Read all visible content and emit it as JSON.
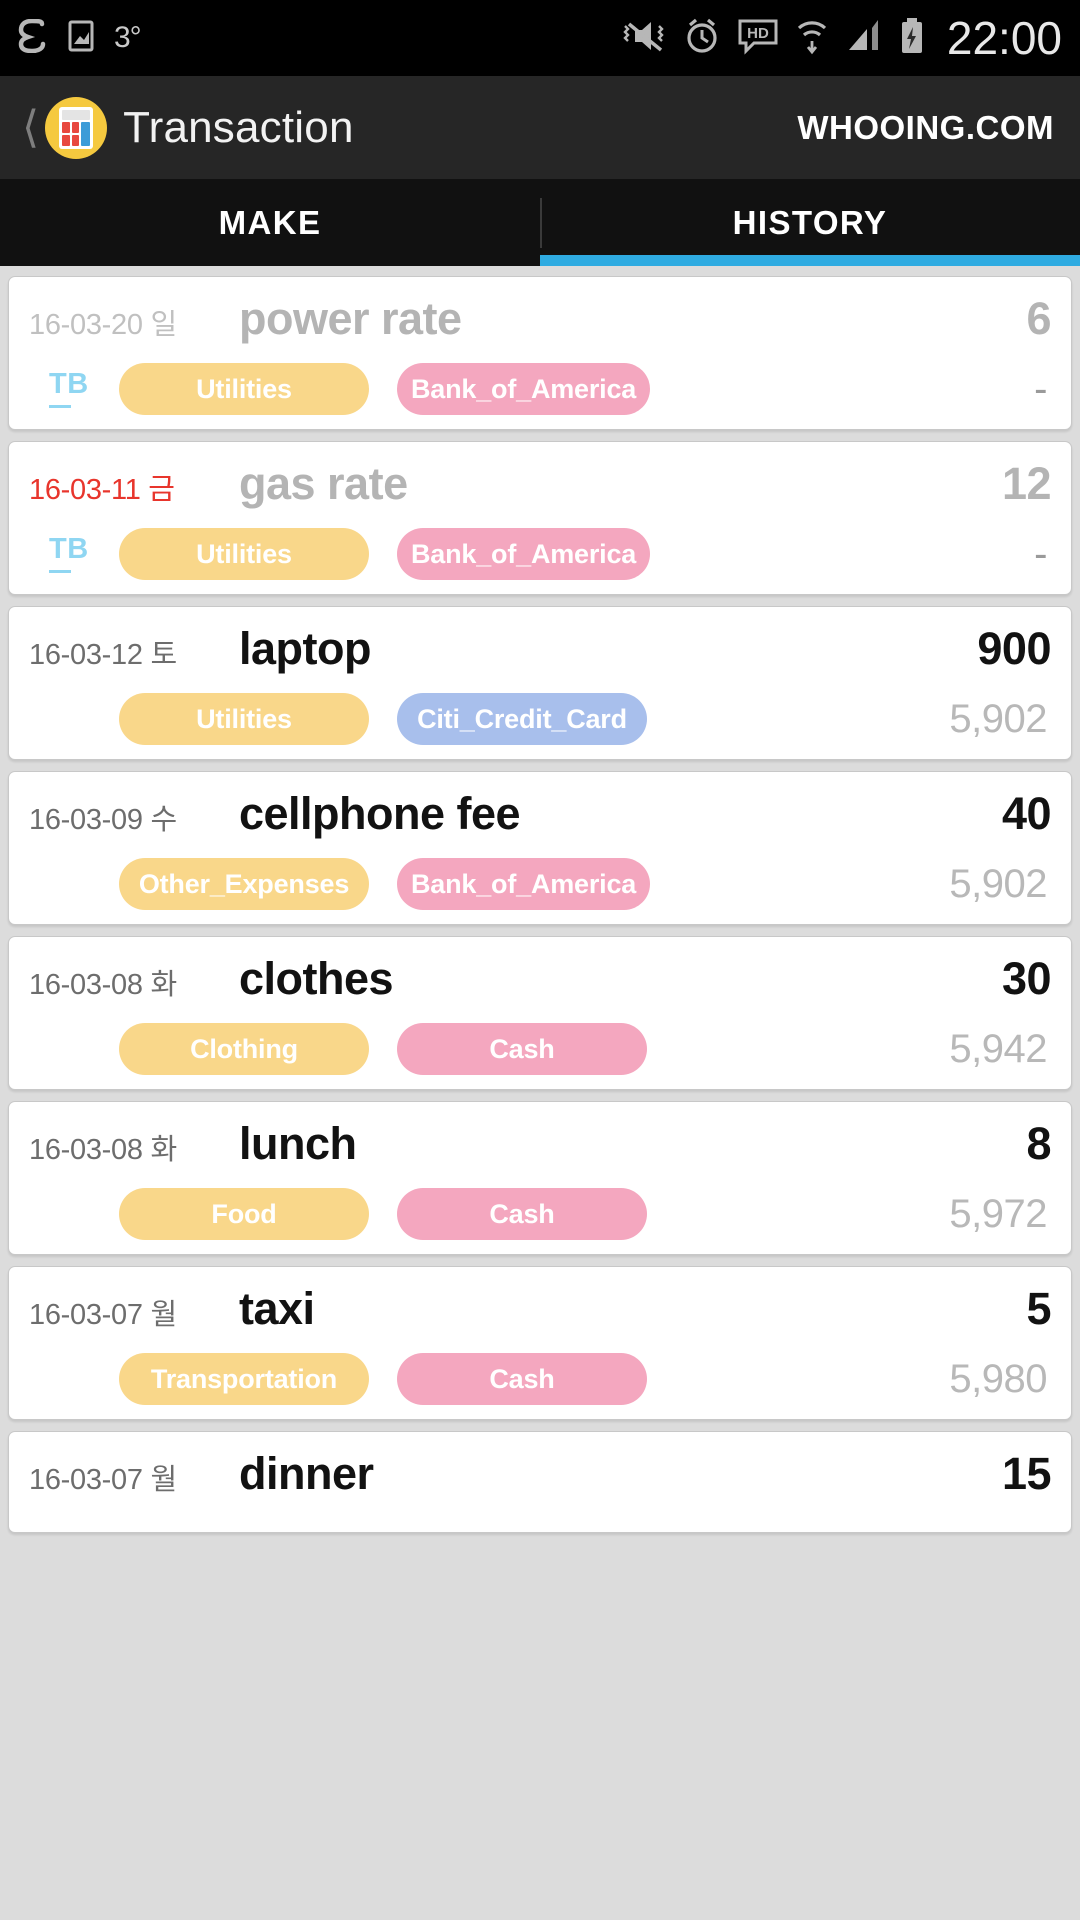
{
  "statusbar": {
    "temperature": "3°",
    "clock": "22:00",
    "icons_left": [
      "sigma-icon",
      "screenshot-icon"
    ],
    "icons_right": [
      "vibrate-mute-icon",
      "alarm-icon",
      "hd-icon",
      "wifi-icon",
      "signal-icon",
      "battery-charging-icon"
    ]
  },
  "appbar": {
    "back_icon": "back-chevron-icon",
    "logo_icon": "calculator-icon",
    "title": "Transaction",
    "brand": "WHOOING.COM"
  },
  "tabs": {
    "items": [
      {
        "label": "MAKE",
        "active": false
      },
      {
        "label": "HISTORY",
        "active": true
      }
    ],
    "indicator_color": "#2fabe1"
  },
  "transactions": [
    {
      "date": "16-03-20 일",
      "date_style": "muted",
      "title": "power rate",
      "amount": "6",
      "muted": true,
      "tb": "TB",
      "category": "Utilities",
      "category_color": "yellow",
      "account": "Bank_of_America",
      "account_color": "pink",
      "balance": "-"
    },
    {
      "date": "16-03-11 금",
      "date_style": "holiday",
      "title": "gas rate",
      "amount": "12",
      "muted": true,
      "tb": "TB",
      "category": "Utilities",
      "category_color": "yellow",
      "account": "Bank_of_America",
      "account_color": "pink",
      "balance": "-"
    },
    {
      "date": "16-03-12 토",
      "date_style": "normal",
      "title": "laptop",
      "amount": "900",
      "muted": false,
      "tb": "",
      "category": "Utilities",
      "category_color": "yellow",
      "account": "Citi_Credit_Card",
      "account_color": "blue",
      "balance": "5,902"
    },
    {
      "date": "16-03-09 수",
      "date_style": "normal",
      "title": "cellphone fee",
      "amount": "40",
      "muted": false,
      "tb": "",
      "category": "Other_Expenses",
      "category_color": "yellow",
      "account": "Bank_of_America",
      "account_color": "pink",
      "balance": "5,902"
    },
    {
      "date": "16-03-08 화",
      "date_style": "normal",
      "title": "clothes",
      "amount": "30",
      "muted": false,
      "tb": "",
      "category": "Clothing",
      "category_color": "yellow",
      "account": "Cash",
      "account_color": "pink",
      "balance": "5,942"
    },
    {
      "date": "16-03-08 화",
      "date_style": "normal",
      "title": "lunch",
      "amount": "8",
      "muted": false,
      "tb": "",
      "category": "Food",
      "category_color": "yellow",
      "account": "Cash",
      "account_color": "pink",
      "balance": "5,972"
    },
    {
      "date": "16-03-07 월",
      "date_style": "normal",
      "title": "taxi",
      "amount": "5",
      "muted": false,
      "tb": "",
      "category": "Transportation",
      "category_color": "yellow",
      "account": "Cash",
      "account_color": "pink",
      "balance": "5,980"
    },
    {
      "date": "16-03-07 월",
      "date_style": "normal",
      "title": "dinner",
      "amount": "15",
      "muted": false,
      "tb": "",
      "category": "",
      "category_color": "yellow",
      "account": "",
      "account_color": "pink",
      "balance": ""
    }
  ]
}
